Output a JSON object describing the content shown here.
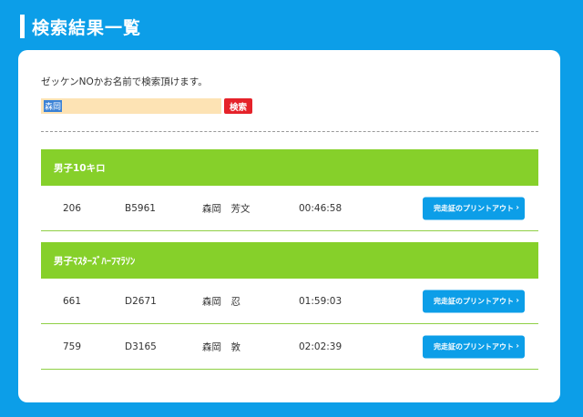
{
  "header": {
    "title": "検索結果一覧"
  },
  "search": {
    "instruction": "ゼッケンNOかお名前で検索頂けます。",
    "query": "森岡",
    "button_label": "検索"
  },
  "categories": [
    {
      "name": "男子10キロ",
      "rows": [
        {
          "bib": "206",
          "id": "B5961",
          "name": "森岡　芳文",
          "time": "00:46:58",
          "button": "完走証のプリントアウト"
        }
      ]
    },
    {
      "name": "男子ﾏｽﾀｰｽﾞﾊｰﾌﾏﾗｿﾝ",
      "rows": [
        {
          "bib": "661",
          "id": "D2671",
          "name": "森岡　忍",
          "time": "01:59:03",
          "button": "完走証のプリントアウト"
        },
        {
          "bib": "759",
          "id": "D3165",
          "name": "森岡　敦",
          "time": "02:02:39",
          "button": "完走証のプリントアウト"
        }
      ]
    }
  ],
  "icons": {
    "print_chevron": "chevron-right-icon"
  },
  "colors": {
    "background": "#0c9ee8",
    "category_header": "#86d02a",
    "search_button": "#e5222a",
    "input_bg": "#fde3b4"
  }
}
